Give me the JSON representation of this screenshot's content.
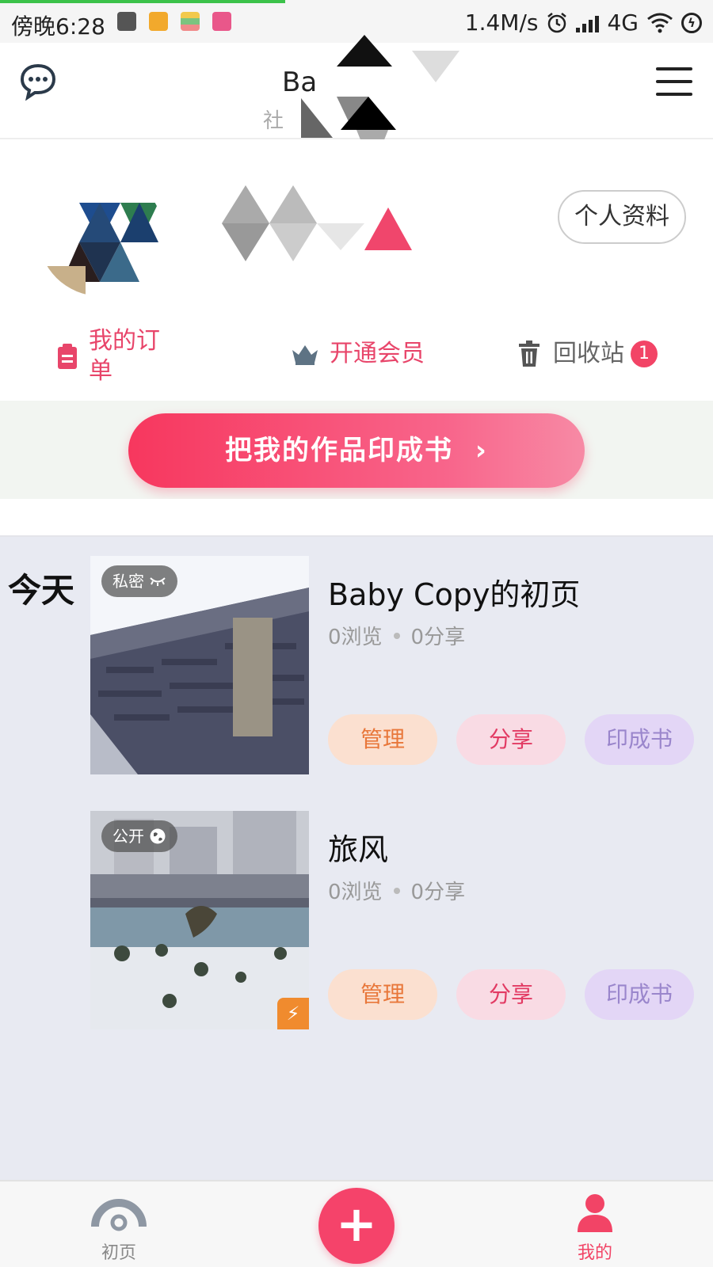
{
  "status_bar": {
    "time": "傍晚6:28",
    "network_speed": "1.4M/s",
    "network_type": "4G",
    "notification_icons": [
      "square-notification-icon",
      "bear-app-icon",
      "stripes-app-icon",
      "pink-app-icon"
    ],
    "right_icons": [
      "alarm-icon",
      "signal-icon",
      "wifi-icon",
      "charging-icon"
    ]
  },
  "header": {
    "title": "Ba",
    "subtitle": "社",
    "left_icon": "chat-bubble-icon",
    "right_icon": "hamburger-menu-icon"
  },
  "profile": {
    "profile_button_label": "个人资料"
  },
  "quick_actions": [
    {
      "label": "我的订单",
      "icon": "clipboard-icon",
      "color": "#e8456a"
    },
    {
      "label": "开通会员",
      "icon": "crown-icon",
      "color": "#e8456a"
    },
    {
      "label": "回收站",
      "icon": "trash-icon",
      "color": "#666666",
      "badge": "1"
    }
  ],
  "promo": {
    "label": "把我的作品印成书",
    "icon": "chevron-right-icon"
  },
  "works": {
    "date_group": "今天",
    "items": [
      {
        "title": "Baby Copy的初页",
        "privacy_tag": "私密",
        "privacy_icon": "closed-eye-icon",
        "views": "0浏览",
        "shares": "0分享",
        "actions": {
          "manage": "管理",
          "share": "分享",
          "print": "印成书"
        },
        "thumbnail": "great-wall-photo"
      },
      {
        "title": "旅风",
        "privacy_tag": "公开",
        "privacy_icon": "globe-icon",
        "views": "0浏览",
        "shares": "0分享",
        "actions": {
          "manage": "管理",
          "share": "分享",
          "print": "印成书"
        },
        "thumbnail": "city-park-photo",
        "corner_icon": "lightning-icon"
      }
    ]
  },
  "bottom_nav": {
    "home_label": "初页",
    "add_icon": "plus-icon",
    "add_label": "+",
    "me_label": "我的"
  },
  "colors": {
    "accent": "#f24466",
    "promo_gradient": [
      "#f7375e",
      "#f78aa5"
    ],
    "list_background": "#e8eaf2"
  }
}
